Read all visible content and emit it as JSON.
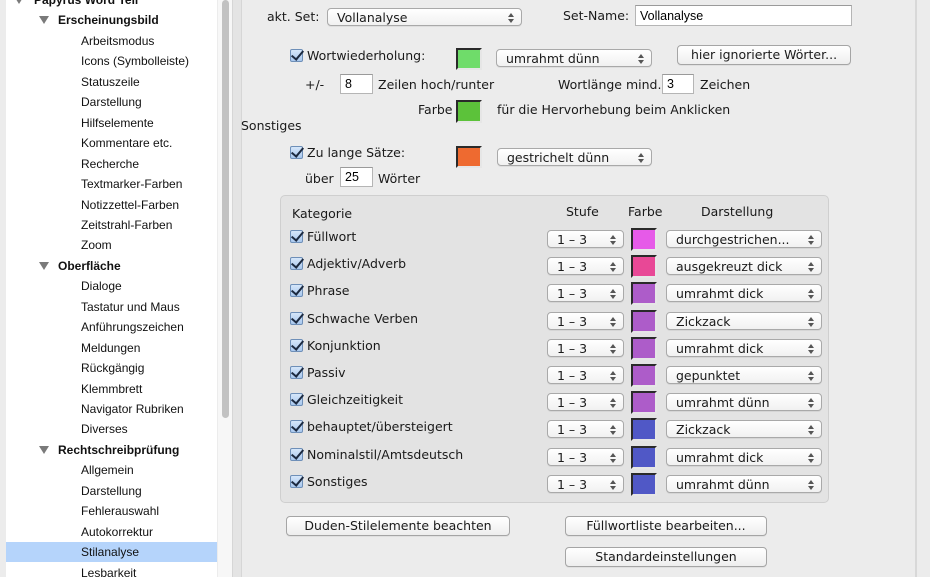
{
  "sidebar": {
    "items": [
      {
        "label": "Papyrus Word Tell",
        "level": 0,
        "expanded": true
      },
      {
        "label": "Erscheinungsbild",
        "level": 1,
        "expanded": true
      },
      {
        "label": "Arbeitsmodus",
        "level": 2
      },
      {
        "label": "Icons (Symbolleiste)",
        "level": 2
      },
      {
        "label": "Statuszeile",
        "level": 2
      },
      {
        "label": "Darstellung",
        "level": 2
      },
      {
        "label": "Hilfselemente",
        "level": 2
      },
      {
        "label": "Kommentare etc.",
        "level": 2
      },
      {
        "label": "Recherche",
        "level": 2
      },
      {
        "label": "Textmarker-Farben",
        "level": 2
      },
      {
        "label": "Notizzettel-Farben",
        "level": 2
      },
      {
        "label": "Zeitstrahl-Farben",
        "level": 2
      },
      {
        "label": "Zoom",
        "level": 2
      },
      {
        "label": "Oberfläche",
        "level": 1,
        "expanded": true
      },
      {
        "label": "Dialoge",
        "level": 2
      },
      {
        "label": "Tastatur und Maus",
        "level": 2
      },
      {
        "label": "Anführungszeichen",
        "level": 2
      },
      {
        "label": "Meldungen",
        "level": 2
      },
      {
        "label": "Rückgängig",
        "level": 2
      },
      {
        "label": "Klemmbrett",
        "level": 2
      },
      {
        "label": "Navigator Rubriken",
        "level": 2
      },
      {
        "label": "Diverses",
        "level": 2
      },
      {
        "label": "Rechtschreibprüfung",
        "level": 1,
        "expanded": true
      },
      {
        "label": "Allgemein",
        "level": 2
      },
      {
        "label": "Darstellung",
        "level": 2
      },
      {
        "label": "Fehlerauswahl",
        "level": 2
      },
      {
        "label": "Autokorrektur",
        "level": 2
      },
      {
        "label": "Stilanalyse",
        "level": 2,
        "selected": true
      },
      {
        "label": "Lesbarkeit",
        "level": 2
      }
    ]
  },
  "set": {
    "label": "akt. Set:",
    "value": "Vollanalyse",
    "name_label": "Set-Name:",
    "name_value": "Vollanalyse"
  },
  "repetition": {
    "checkbox_label": "Wortwiederholung:",
    "checked": true,
    "color": "#6fdc6a",
    "style_value": "umrahmt dünn",
    "ignored_words_button": "hier ignorierte Wörter...",
    "range_prefix": "+/-",
    "range_value": "8",
    "range_suffix": "Zeilen hoch/runter",
    "min_length_label": "Wortlänge mind.",
    "min_length_value": "3",
    "min_length_suffix": "Zeichen",
    "highlight_label": "Farbe",
    "highlight_color": "#5cc23a",
    "highlight_suffix": "für die Hervorhebung beim Anklicken"
  },
  "misc": {
    "section_title": "Sonstiges",
    "long_sentences_label": "Zu lange Sätze:",
    "long_sentences_checked": true,
    "long_sentences_color": "#ee6a30",
    "long_sentences_style": "gestrichelt dünn",
    "over_label": "über",
    "over_value": "25",
    "words_label": "Wörter"
  },
  "table": {
    "headers": {
      "category": "Kategorie",
      "level": "Stufe",
      "color": "Farbe",
      "style": "Darstellung"
    },
    "rows": [
      {
        "category": "Füllwort",
        "checked": true,
        "level": "1 – 3",
        "color": "#e65ae8",
        "style": "durchgestrichen..."
      },
      {
        "category": "Adjektiv/Adverb",
        "checked": true,
        "level": "1 – 3",
        "color": "#e84896",
        "style": "ausgekreuzt dick"
      },
      {
        "category": "Phrase",
        "checked": true,
        "level": "1 – 3",
        "color": "#ad5cc9",
        "style": "umrahmt dick"
      },
      {
        "category": "Schwache Verben",
        "checked": true,
        "level": "1 – 3",
        "color": "#ad5cc9",
        "style": "Zickzack"
      },
      {
        "category": "Konjunktion",
        "checked": true,
        "level": "1 – 3",
        "color": "#ad5cc9",
        "style": "umrahmt dick"
      },
      {
        "category": "Passiv",
        "checked": true,
        "level": "1 – 3",
        "color": "#ad5cc9",
        "style": "gepunktet"
      },
      {
        "category": "Gleichzeitigkeit",
        "checked": true,
        "level": "1 – 3",
        "color": "#ad5cc9",
        "style": "umrahmt dünn"
      },
      {
        "category": "behauptet/übersteigert",
        "checked": true,
        "level": "1 – 3",
        "color": "#5058c6",
        "style": "Zickzack"
      },
      {
        "category": "Nominalstil/Amtsdeutsch",
        "checked": true,
        "level": "1 – 3",
        "color": "#5058c6",
        "style": "umrahmt dick"
      },
      {
        "category": "Sonstiges",
        "checked": true,
        "level": "1 – 3",
        "color": "#5058c6",
        "style": "umrahmt dünn"
      }
    ]
  },
  "buttons": {
    "duden": "Duden-Stilelemente beachten",
    "filler_list": "Füllwortliste bearbeiten...",
    "defaults": "Standardeinstellungen"
  }
}
